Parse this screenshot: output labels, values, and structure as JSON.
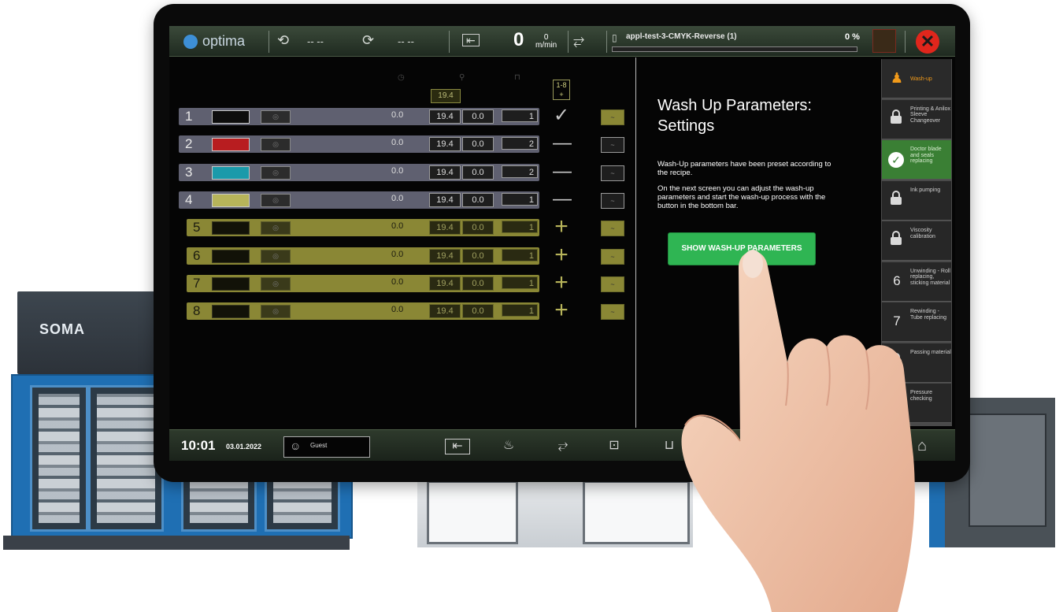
{
  "background": {
    "machine_logo": "SOMA"
  },
  "topbar": {
    "app_logo": "optima",
    "unwind_icon": "unwind-icon",
    "unwind_value": "-- --",
    "rewind_icon": "rewind-icon",
    "rewind_value": "-- --",
    "speed_value": "0",
    "speed_top": "0",
    "speed_unit": "m/min",
    "job_file": "appl-test-3-CMYK-Reverse (1)",
    "job_progress_percent": 0,
    "progress_label": "0 %",
    "close_icon": "close-icon",
    "close_glyph": "✕"
  },
  "units": {
    "total_value": "19.4",
    "all_button_top": "1-8",
    "all_button_bottom": "+",
    "rows": [
      {
        "num": "1",
        "active": true,
        "color": "#0d0d0d",
        "value": "0.0",
        "a": "19.4",
        "b": "0.0",
        "c": "1",
        "action": "✓"
      },
      {
        "num": "2",
        "active": true,
        "color": "#b81d20",
        "value": "0.0",
        "a": "19.4",
        "b": "0.0",
        "c": "2",
        "action": "—"
      },
      {
        "num": "3",
        "active": true,
        "color": "#1b9aaa",
        "value": "0.0",
        "a": "19.4",
        "b": "0.0",
        "c": "2",
        "action": "—"
      },
      {
        "num": "4",
        "active": true,
        "color": "#b7b45a",
        "value": "0.0",
        "a": "19.4",
        "b": "0.0",
        "c": "1",
        "action": "—"
      },
      {
        "num": "5",
        "active": false,
        "color": "#121208",
        "value": "0.0",
        "a": "19.4",
        "b": "0.0",
        "c": "1",
        "action": "+"
      },
      {
        "num": "6",
        "active": false,
        "color": "#121208",
        "value": "0.0",
        "a": "19.4",
        "b": "0.0",
        "c": "1",
        "action": "+"
      },
      {
        "num": "7",
        "active": false,
        "color": "#121208",
        "value": "0.0",
        "a": "19.4",
        "b": "0.0",
        "c": "1",
        "action": "+"
      },
      {
        "num": "8",
        "active": false,
        "color": "#121208",
        "value": "0.0",
        "a": "19.4",
        "b": "0.0",
        "c": "1",
        "action": "+"
      }
    ]
  },
  "panel": {
    "title": "Wash Up Parameters: Settings",
    "paragraph1": "Wash-Up parameters have been preset according to the recipe.",
    "paragraph2": "On the next screen you can adjust the wash-up parameters and start the wash-up process with the button in the bottom bar.",
    "button_label": "SHOW WASH-UP PARAMETERS"
  },
  "steps": [
    {
      "label": "Wash-up",
      "state": "current",
      "icon": "person-icon"
    },
    {
      "label": "Printing & Anilox Sleeve Changeover",
      "state": "locked",
      "icon": "lock-icon"
    },
    {
      "label": "Doctor blade and seals replacing",
      "state": "done",
      "icon": "check-icon"
    },
    {
      "label": "Ink pumping",
      "state": "locked",
      "icon": "lock-icon"
    },
    {
      "label": "Viscosity calibration",
      "state": "locked",
      "icon": "lock-icon"
    },
    {
      "label": "Unwinding - Roll replacing, sticking material",
      "state": "number",
      "icon": "6"
    },
    {
      "label": "Rewinding - Tube replacing",
      "state": "number",
      "icon": "7"
    },
    {
      "label": "Passing material",
      "state": "locked",
      "icon": "lock-icon"
    },
    {
      "label": "Pressure checking",
      "state": "plain",
      "icon": ""
    }
  ],
  "bottombar": {
    "time": "10:01",
    "date": "03.01.2022",
    "user": "Guest"
  }
}
